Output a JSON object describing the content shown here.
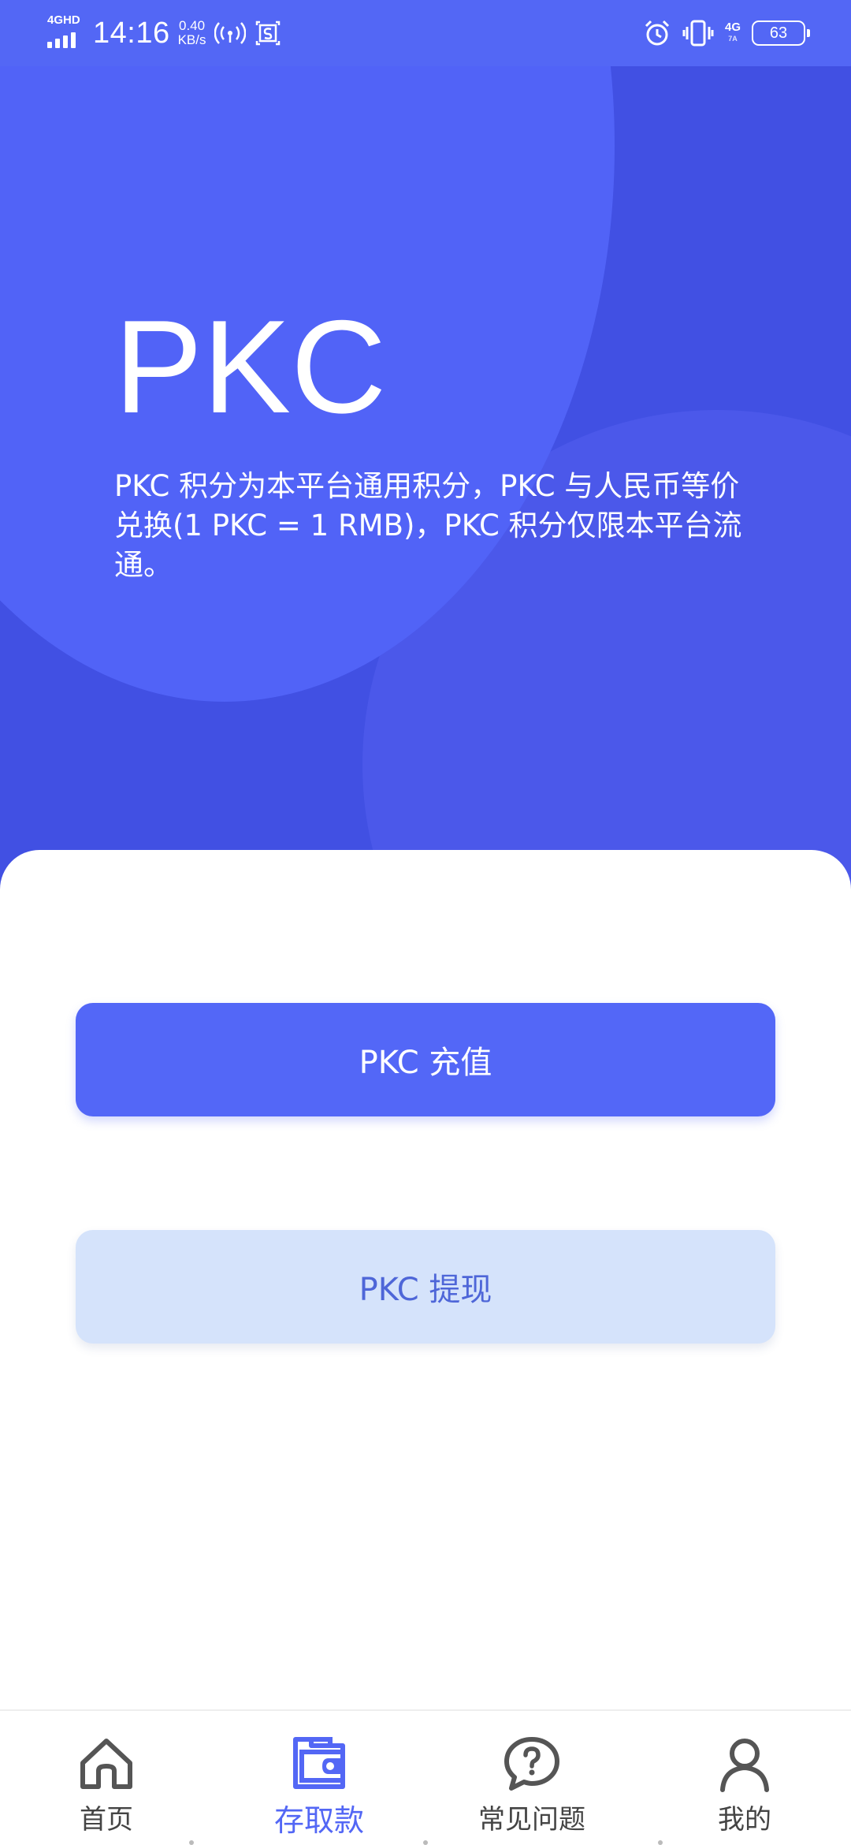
{
  "status_bar": {
    "network_type": "4GHD",
    "time": "14:16",
    "speed_value": "0.40",
    "speed_unit": "KB/s",
    "lte_label": "4G",
    "lte_sub": "7A",
    "battery": "63",
    "signal_strength": 0.75,
    "icons": [
      "hotspot-icon",
      "screenshot-icon",
      "alarm-icon",
      "vibrate-icon"
    ]
  },
  "hero": {
    "title": "PKC",
    "description": "PKC 积分为本平台通用积分，PKC 与人民币等价兑换(1 PKC = 1 RMB)，PKC 积分仅限本平台流通。"
  },
  "actions": {
    "recharge_label": "PKC 充值",
    "withdraw_label": "PKC 提现"
  },
  "bottom_nav": {
    "items": [
      {
        "label": "首页",
        "icon": "home-icon",
        "active": false
      },
      {
        "label": "存取款",
        "icon": "wallet-icon",
        "active": true
      },
      {
        "label": "常见问题",
        "icon": "help-chat-icon",
        "active": false
      },
      {
        "label": "我的",
        "icon": "user-icon",
        "active": false
      }
    ]
  },
  "colors": {
    "primary": "#5367f5",
    "hero_background": "#4150e3",
    "secondary_button": "#d5e3fb",
    "nav_text": "#444444"
  }
}
